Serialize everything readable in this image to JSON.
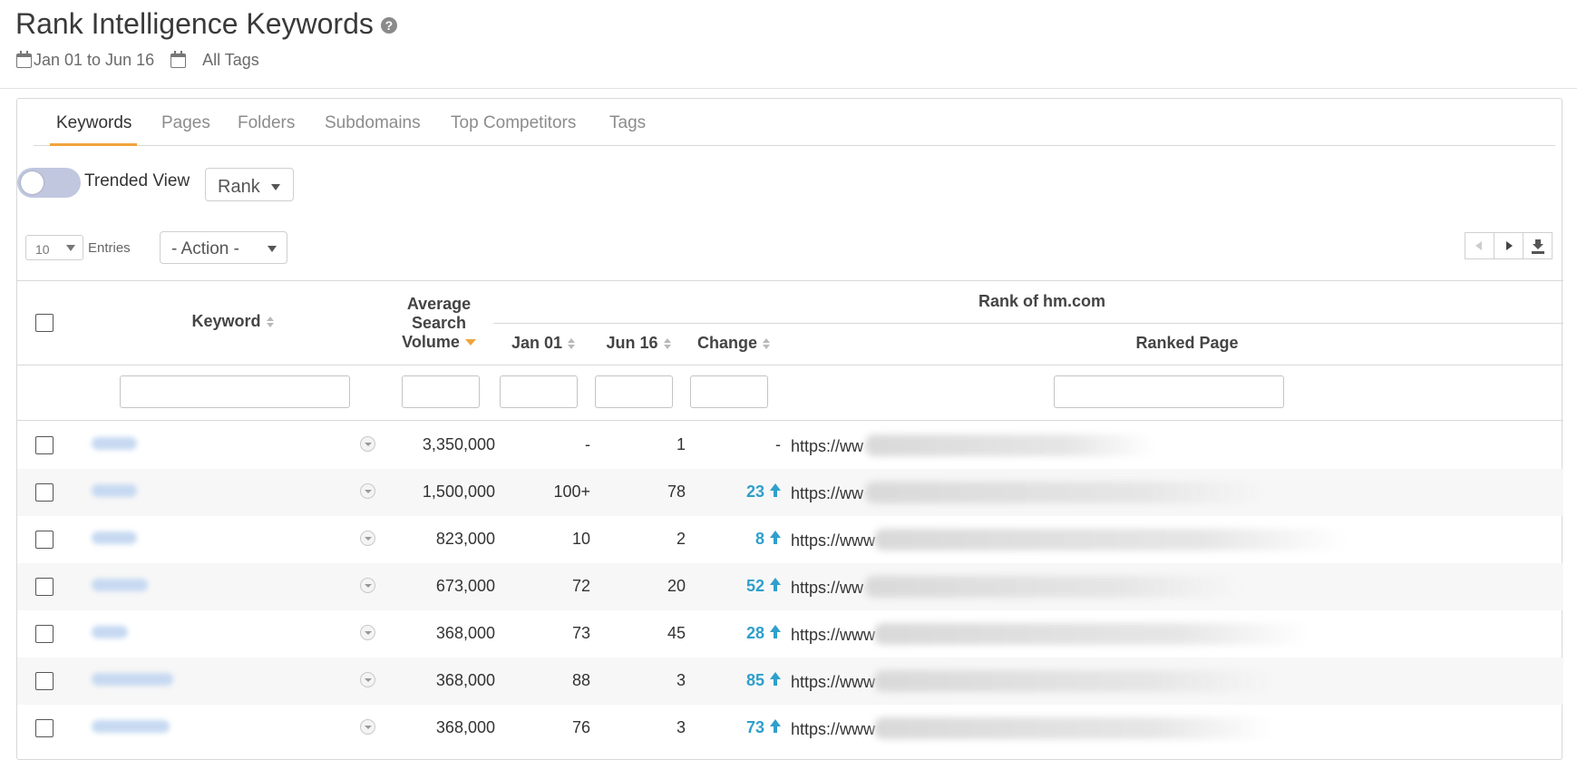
{
  "header": {
    "title": "Rank Intelligence Keywords",
    "help_icon": "question-circle-icon",
    "date_range": "Jan 01 to Jun 16",
    "tags_label": "All Tags"
  },
  "tabs": [
    {
      "label": "Keywords",
      "active": true
    },
    {
      "label": "Pages"
    },
    {
      "label": "Folders"
    },
    {
      "label": "Subdomains"
    },
    {
      "label": "Top Competitors"
    },
    {
      "label": "Tags"
    }
  ],
  "controls": {
    "trended_view_label": "Trended View",
    "trended_view_on": false,
    "metric_select": "Rank",
    "entries_value": "10",
    "entries_label": "Entries",
    "action_select": "- Action -"
  },
  "table": {
    "group_header": "Rank of hm.com",
    "columns": {
      "keyword": "Keyword",
      "volume_line1": "Average",
      "volume_line2": "Search",
      "volume_line3": "Volume",
      "jan": "Jan 01",
      "jun": "Jun 16",
      "change": "Change",
      "ranked_page": "Ranked Page"
    },
    "rows": [
      {
        "volume": "3,350,000",
        "jan": "-",
        "jun": "1",
        "change": "-",
        "change_dir": "none",
        "url": "https://ww"
      },
      {
        "volume": "1,500,000",
        "jan": "100+",
        "jun": "78",
        "change": "23",
        "change_dir": "up",
        "url": "https://ww"
      },
      {
        "volume": "823,000",
        "jan": "10",
        "jun": "2",
        "change": "8",
        "change_dir": "up",
        "url": "https://www"
      },
      {
        "volume": "673,000",
        "jan": "72",
        "jun": "20",
        "change": "52",
        "change_dir": "up",
        "url": "https://ww"
      },
      {
        "volume": "368,000",
        "jan": "73",
        "jun": "45",
        "change": "28",
        "change_dir": "up",
        "url": "https://www"
      },
      {
        "volume": "368,000",
        "jan": "88",
        "jun": "3",
        "change": "85",
        "change_dir": "up",
        "url": "https://www"
      },
      {
        "volume": "368,000",
        "jan": "76",
        "jun": "3",
        "change": "73",
        "change_dir": "up",
        "url": "https://www"
      }
    ]
  },
  "colors": {
    "accent": "#f0a43c",
    "link_blue": "#2f9fcc",
    "toggle": "#c0c7df"
  }
}
